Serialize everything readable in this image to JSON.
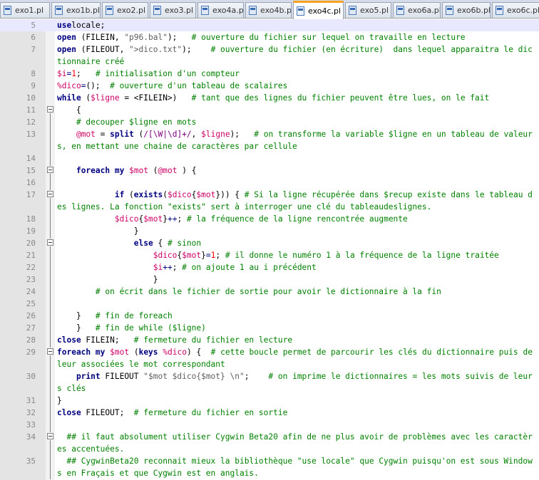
{
  "tabs": [
    {
      "label": "exo1.pl",
      "active": false
    },
    {
      "label": "exo1b.pl",
      "active": false
    },
    {
      "label": "exo2.pl",
      "active": false
    },
    {
      "label": "exo3.pl",
      "active": false
    },
    {
      "label": "exo4a.pl",
      "active": false
    },
    {
      "label": "exo4b.pl",
      "active": false
    },
    {
      "label": "exo4c.pl",
      "active": true
    },
    {
      "label": "exo5.pl",
      "active": false
    },
    {
      "label": "exo6a.pl",
      "active": false
    },
    {
      "label": "exo6b.pl",
      "active": false
    },
    {
      "label": "exo6c.pl",
      "active": false
    }
  ],
  "lines": [
    {
      "n": "5",
      "current": true,
      "fold": false,
      "s": [
        [
          "k",
          "use"
        ],
        [
          "",
          "locale;"
        ]
      ]
    },
    {
      "n": "6",
      "s": [
        [
          "k",
          "open"
        ],
        [
          "",
          " (FILEIN, "
        ],
        [
          "s",
          "\"p96.bal\""
        ],
        [
          "",
          ");   "
        ],
        [
          "c",
          "# ouverture du fichier sur lequel on travaille en lecture"
        ]
      ]
    },
    {
      "n": "7",
      "s": [
        [
          "k",
          "open"
        ],
        [
          "",
          " (FILEOUT, "
        ],
        [
          "s",
          "\">dico.txt\""
        ],
        [
          "",
          ");    "
        ],
        [
          "c",
          "# ouverture du fichier (en écriture)  dans lequel apparaitra le dictionnaire créé"
        ]
      ]
    },
    {
      "n": "8",
      "s": [
        [
          "v",
          "$i"
        ],
        [
          "o",
          "="
        ],
        [
          "n",
          "1"
        ],
        [
          "",
          ";   "
        ],
        [
          "c",
          "# initialisation d'un compteur"
        ]
      ]
    },
    {
      "n": "9",
      "s": [
        [
          "v",
          "%dico"
        ],
        [
          "o",
          "="
        ],
        [
          "",
          "();  "
        ],
        [
          "c",
          "# ouverture d'un tableau de scalaires"
        ]
      ]
    },
    {
      "n": "10",
      "s": [
        [
          "k",
          "while"
        ],
        [
          "",
          " ("
        ],
        [
          "v",
          "$ligne"
        ],
        [
          "",
          " = <FILEIN>)   "
        ],
        [
          "c",
          "# tant que des lignes du fichier peuvent être lues, on le fait"
        ]
      ]
    },
    {
      "n": "11",
      "fold": true,
      "s": [
        [
          "",
          "    {"
        ]
      ]
    },
    {
      "n": "12",
      "s": [
        [
          "",
          "    "
        ],
        [
          "c",
          "# decouper $ligne en mots"
        ]
      ]
    },
    {
      "n": "13",
      "s": [
        [
          "",
          "    "
        ],
        [
          "v",
          "@mot"
        ],
        [
          "",
          " = "
        ],
        [
          "k",
          "split"
        ],
        [
          "",
          " ("
        ],
        [
          "r",
          "/[\\W|\\d]+/"
        ],
        [
          "",
          ", "
        ],
        [
          "v",
          "$ligne"
        ],
        [
          "",
          ");   "
        ],
        [
          "c",
          "# on transforme la variable $ligne en un tableau de valeurs, en mettant une chaine de caractères par cellule"
        ]
      ]
    },
    {
      "n": "14",
      "s": [
        [
          "",
          ""
        ]
      ]
    },
    {
      "n": "15",
      "fold": true,
      "s": [
        [
          "",
          "    "
        ],
        [
          "k",
          "foreach"
        ],
        [
          "",
          " "
        ],
        [
          "k",
          "my"
        ],
        [
          "",
          " "
        ],
        [
          "v",
          "$mot"
        ],
        [
          "",
          " ("
        ],
        [
          "v",
          "@mot"
        ],
        [
          "",
          " ) {"
        ]
      ]
    },
    {
      "n": "16",
      "s": [
        [
          "",
          ""
        ]
      ]
    },
    {
      "n": "17",
      "fold": true,
      "s": [
        [
          "",
          "            "
        ],
        [
          "k",
          "if"
        ],
        [
          "",
          " ("
        ],
        [
          "k",
          "exists"
        ],
        [
          "",
          "("
        ],
        [
          "v",
          "$dico"
        ],
        [
          "",
          "{"
        ],
        [
          "v",
          "$mot"
        ],
        [
          "",
          "})) { "
        ],
        [
          "c",
          "# Si la ligne récupérée dans $recup existe dans le tableau des lignes. La fonction \"exists\" sert à interroger une clé du tableaudeslignes."
        ]
      ]
    },
    {
      "n": "18",
      "s": [
        [
          "",
          "            "
        ],
        [
          "v",
          "$dico"
        ],
        [
          "",
          "{"
        ],
        [
          "v",
          "$mot"
        ],
        [
          "",
          "}"
        ],
        [
          "o",
          "++"
        ],
        [
          "",
          "; "
        ],
        [
          "c",
          "# la fréquence de la ligne rencontrée augmente"
        ]
      ]
    },
    {
      "n": "19",
      "s": [
        [
          "",
          "                }"
        ]
      ]
    },
    {
      "n": "20",
      "fold": true,
      "s": [
        [
          "",
          "                "
        ],
        [
          "k",
          "else"
        ],
        [
          "",
          " { "
        ],
        [
          "c",
          "# sinon"
        ]
      ]
    },
    {
      "n": "21",
      "s": [
        [
          "",
          "                    "
        ],
        [
          "v",
          "$dico"
        ],
        [
          "",
          "{"
        ],
        [
          "v",
          "$mot"
        ],
        [
          "",
          "}"
        ],
        [
          "o",
          "="
        ],
        [
          "n",
          "1"
        ],
        [
          "",
          "; "
        ],
        [
          "c",
          "# il donne le numéro 1 à la fréquence de la ligne traitée"
        ]
      ]
    },
    {
      "n": "22",
      "s": [
        [
          "",
          "                    "
        ],
        [
          "v",
          "$i"
        ],
        [
          "o",
          "++"
        ],
        [
          "",
          "; "
        ],
        [
          "c",
          "# on ajoute 1 au i précédent"
        ]
      ]
    },
    {
      "n": "23",
      "s": [
        [
          "",
          "                    }"
        ]
      ]
    },
    {
      "n": "24",
      "s": [
        [
          "",
          "        "
        ],
        [
          "c",
          "# on écrit dans le fichier de sortie pour avoir le dictionnaire à la fin"
        ]
      ]
    },
    {
      "n": "25",
      "s": [
        [
          "",
          ""
        ]
      ]
    },
    {
      "n": "26",
      "s": [
        [
          "",
          "    }   "
        ],
        [
          "c",
          "# fin de foreach"
        ]
      ]
    },
    {
      "n": "27",
      "s": [
        [
          "",
          "    }   "
        ],
        [
          "c",
          "# fin de while ($ligne)"
        ]
      ]
    },
    {
      "n": "28",
      "s": [
        [
          "k",
          "close"
        ],
        [
          "",
          " FILEIN;   "
        ],
        [
          "c",
          "# fermeture du fichier en lecture"
        ]
      ]
    },
    {
      "n": "29",
      "fold": true,
      "s": [
        [
          "k",
          "foreach"
        ],
        [
          "",
          " "
        ],
        [
          "k",
          "my"
        ],
        [
          "",
          " "
        ],
        [
          "v",
          "$mot"
        ],
        [
          "",
          " ("
        ],
        [
          "k",
          "keys"
        ],
        [
          "",
          " "
        ],
        [
          "v",
          "%dico"
        ],
        [
          "",
          ") {  "
        ],
        [
          "c",
          "# cette boucle permet de parcourir les clés du dictionnaire puis de leur associées le mot correspondant"
        ]
      ]
    },
    {
      "n": "30",
      "s": [
        [
          "",
          "    "
        ],
        [
          "k",
          "print"
        ],
        [
          "",
          " FILEOUT "
        ],
        [
          "s",
          "\"$mot $dico{$mot} \\n\""
        ],
        [
          "",
          ";    "
        ],
        [
          "c",
          "# on imprime le dictionnaires = les mots suivis de leurs clés"
        ]
      ]
    },
    {
      "n": "31",
      "s": [
        [
          "",
          "}"
        ]
      ]
    },
    {
      "n": "32",
      "s": [
        [
          "k",
          "close"
        ],
        [
          "",
          " FILEOUT;  "
        ],
        [
          "c",
          "# fermeture du fichier en sortie"
        ]
      ]
    },
    {
      "n": "33",
      "s": [
        [
          "",
          ""
        ]
      ]
    },
    {
      "n": "34",
      "fold": true,
      "s": [
        [
          "",
          "  "
        ],
        [
          "c",
          "## il faut absolument utiliser Cygwin Beta20 afin de ne plus avoir de problèmes avec les caractères accentuées."
        ]
      ]
    },
    {
      "n": "35",
      "s": [
        [
          "",
          "  "
        ],
        [
          "c",
          "## CygwinBeta20 reconnait mieux la bibliothèque \"use locale\" que Cygwin puisqu'on est sous Windows en Fraçais et que Cygwin est en anglais."
        ]
      ]
    }
  ]
}
